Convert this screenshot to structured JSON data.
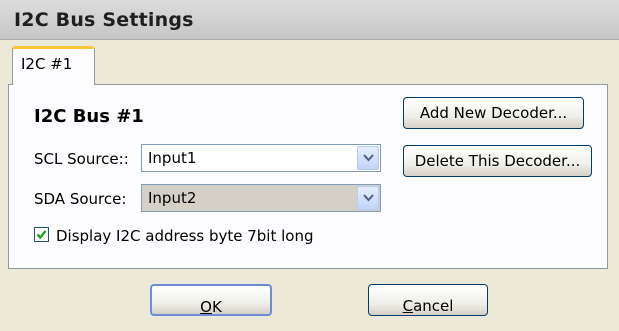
{
  "window": {
    "title": "I2C Bus Settings"
  },
  "tabs": [
    {
      "label": "I2C #1",
      "active": true
    }
  ],
  "panel": {
    "group_title": "I2C Bus #1",
    "scl": {
      "label": "SCL Source::",
      "value": "Input1"
    },
    "sda": {
      "label": "SDA Source:",
      "value": "Input2"
    },
    "checkbox": {
      "label": "Display I2C address byte 7bit long",
      "checked": true
    }
  },
  "buttons": {
    "add_decoder": "Add New Decoder...",
    "delete_decoder": "Delete This Decoder...",
    "ok_mnemonic": "O",
    "ok_rest": "K",
    "cancel_mnemonic": "C",
    "cancel_rest": "ancel"
  },
  "icons": {
    "combo_arrow": "chevron-down-icon",
    "check": "checkmark-icon"
  },
  "colors": {
    "window_bg": "#ece9d8",
    "tab_accent": "#ffc83c",
    "button_border": "#003c74",
    "check_green": "#21a121"
  }
}
